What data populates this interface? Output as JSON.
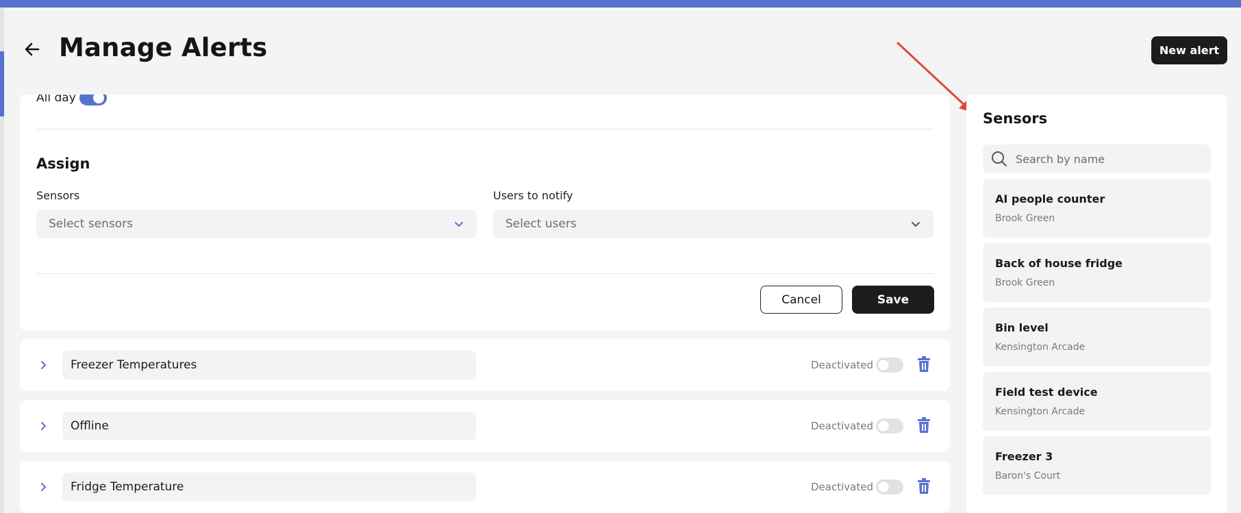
{
  "header": {
    "title": "Manage Alerts",
    "new_alert_label": "New alert"
  },
  "edit_form": {
    "all_day_label": "All day",
    "all_day_enabled": true,
    "assign_title": "Assign",
    "sensors_label": "Sensors",
    "sensors_placeholder": "Select sensors",
    "users_label": "Users to notify",
    "users_placeholder": "Select users",
    "cancel_label": "Cancel",
    "save_label": "Save"
  },
  "alerts": [
    {
      "name": "Freezer Temperatures",
      "status": "Deactivated",
      "active": false
    },
    {
      "name": "Offline",
      "status": "Deactivated",
      "active": false
    },
    {
      "name": "Fridge Temperature",
      "status": "Deactivated",
      "active": false
    }
  ],
  "sensors_panel": {
    "title": "Sensors",
    "search_placeholder": "Search by name",
    "items": [
      {
        "name": "AI people counter",
        "location": "Brook Green"
      },
      {
        "name": "Back of house fridge",
        "location": "Brook Green"
      },
      {
        "name": "Bin level",
        "location": "Kensington Arcade"
      },
      {
        "name": "Field test device",
        "location": "Kensington Arcade"
      },
      {
        "name": "Freezer 3",
        "location": "Baron's Court"
      }
    ]
  },
  "colors": {
    "accent": "#5872d0",
    "dark_button": "#1c1c1c",
    "annotation_arrow": "#e0473a"
  },
  "icons": {
    "back": "arrow-left-icon",
    "expand": "chevron-right-icon",
    "dropdown": "chevron-down-icon",
    "delete": "trash-icon",
    "search": "search-icon"
  }
}
